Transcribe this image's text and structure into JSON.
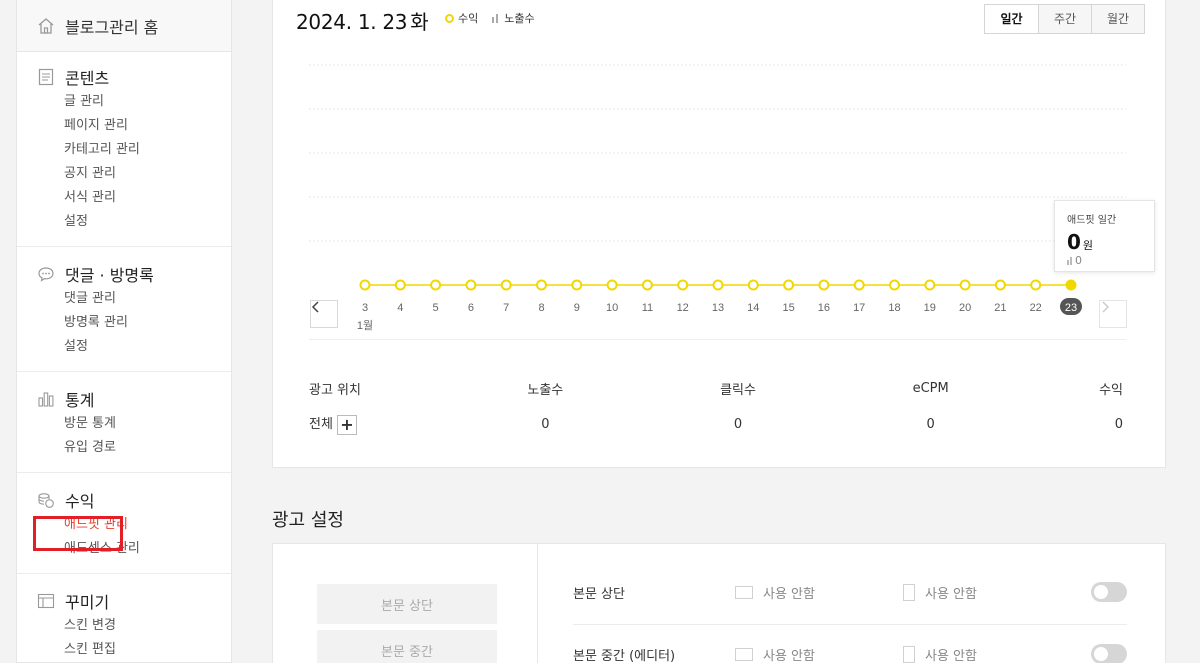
{
  "sidebar": {
    "home": "블로그관리 홈",
    "sections": [
      {
        "title": "콘텐츠",
        "icon": "document-icon",
        "items": [
          "글 관리",
          "페이지 관리",
          "카테고리 관리",
          "공지 관리",
          "서식 관리",
          "설정"
        ]
      },
      {
        "title": "댓글 · 방명록",
        "icon": "speech-bubble-icon",
        "items": [
          "댓글 관리",
          "방명록 관리",
          "설정"
        ]
      },
      {
        "title": "통계",
        "icon": "bar-chart-icon",
        "items": [
          "방문 통계",
          "유입 경로"
        ]
      },
      {
        "title": "수익",
        "icon": "coins-icon",
        "items": [
          "애드핏 관리",
          "애드센스 관리"
        ]
      },
      {
        "title": "꾸미기",
        "icon": "layout-icon",
        "items": [
          "스킨 변경",
          "스킨 편집"
        ]
      }
    ]
  },
  "header": {
    "date": "2024. 1. 23",
    "weekday": "화",
    "legend_revenue": "수익",
    "legend_impressions": "노출수",
    "tabs": [
      "일간",
      "주간",
      "월간"
    ]
  },
  "chart_data": {
    "type": "line",
    "x": [
      "3",
      "4",
      "5",
      "6",
      "7",
      "8",
      "9",
      "10",
      "11",
      "12",
      "13",
      "14",
      "15",
      "16",
      "17",
      "18",
      "19",
      "20",
      "21",
      "22",
      "23"
    ],
    "x_month_label": "1월",
    "series": [
      {
        "name": "수익",
        "values": [
          0,
          0,
          0,
          0,
          0,
          0,
          0,
          0,
          0,
          0,
          0,
          0,
          0,
          0,
          0,
          0,
          0,
          0,
          0,
          0,
          0
        ]
      }
    ],
    "selected": "23",
    "grid": true,
    "colors": {
      "line": "#f0d800",
      "selected_bg": "#555555"
    }
  },
  "tooltip": {
    "title": "애드핏 일간",
    "value": "0",
    "unit": "원",
    "impressions": "0"
  },
  "stats": {
    "headers": [
      "광고 위치",
      "노출수",
      "클릭수",
      "eCPM",
      "수익"
    ],
    "row_label": "전체",
    "plus": "+",
    "values": [
      "0",
      "0",
      "0",
      "0"
    ]
  },
  "ad_settings": {
    "title": "광고 설정",
    "slots": [
      "본문 상단",
      "본문 중간"
    ],
    "rows": [
      {
        "name": "본문 상단",
        "opt1": "사용 안함",
        "opt2": "사용 안함"
      },
      {
        "name": "본문 중간 (에디터)",
        "opt1": "사용 안함",
        "opt2": "사용 안함"
      }
    ]
  }
}
